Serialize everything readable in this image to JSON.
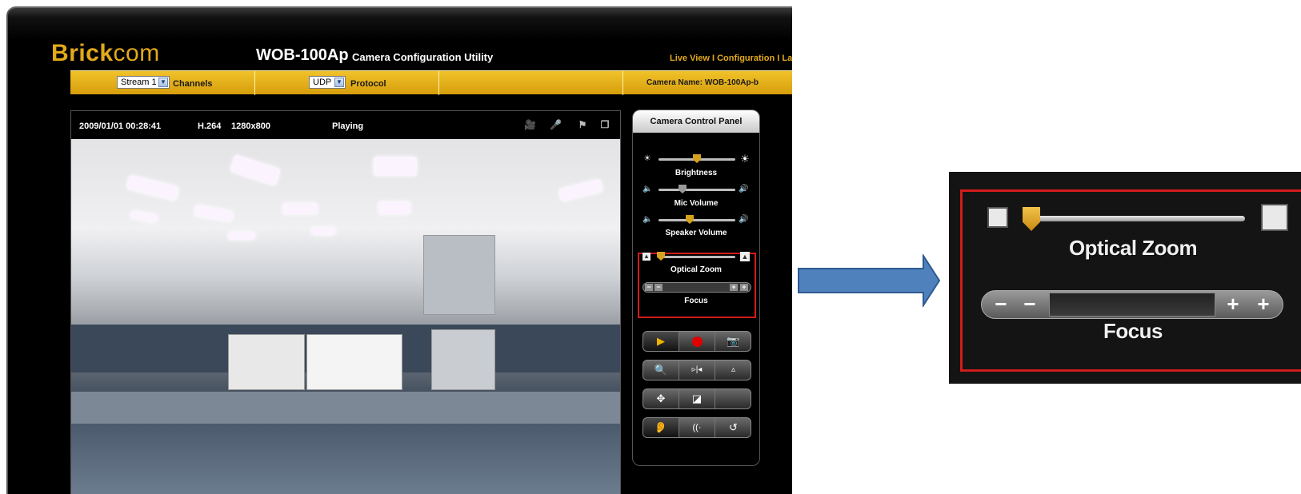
{
  "app": {
    "logo_bold": "Brick",
    "logo_light": "com",
    "model": "WOB-100Ap",
    "utility_title": "Camera Configuration Utility",
    "topnav": "Live View I Configuration I La"
  },
  "toolbar": {
    "stream_value": "Stream 1",
    "channels_label": "Channels",
    "protocol_value": "UDP",
    "protocol_label": "Protocol",
    "camera_name": "Camera Name: WOB-100Ap-b"
  },
  "video": {
    "datetime": "2009/01/01 00:28:41",
    "codec": "H.264",
    "resolution": "1280x800",
    "status": "Playing",
    "icons": [
      "camera-icon",
      "microphone-icon",
      "flag-icon",
      "window-icon"
    ]
  },
  "panel": {
    "title": "Camera Control Panel",
    "brightness_label": "Brightness",
    "mic_volume_label": "Mic Volume",
    "speaker_volume_label": "Speaker Volume",
    "optical_zoom_label": "Optical Zoom",
    "focus_label": "Focus",
    "focus_minus": "−",
    "focus_plus": "+",
    "levels": {
      "brightness": 0.5,
      "mic_volume": 0.32,
      "speaker_volume": 0.42,
      "optical_zoom": 0.04
    },
    "button_rows": [
      [
        "play-icon",
        "record-icon",
        "snapshot-icon"
      ],
      [
        "digital-zoom-icon",
        "mirror-icon",
        "flip-icon"
      ],
      [
        "move-icon",
        "corridor-icon",
        "blank"
      ],
      [
        "listen-icon",
        "talk-icon",
        "rotate-icon"
      ]
    ]
  },
  "inset": {
    "optical_zoom_label": "Optical Zoom",
    "focus_label": "Focus",
    "minus": "−",
    "plus": "+"
  },
  "colors": {
    "accent": "#e2a91b",
    "highlight": "#d21b1b",
    "arrow": "#4f81bd"
  }
}
